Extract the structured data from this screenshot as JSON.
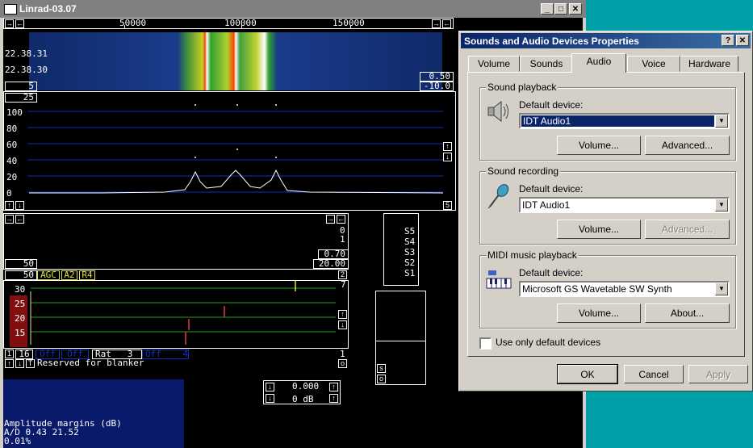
{
  "linrad": {
    "title": "Linrad-03.07",
    "freq_ticks": [
      "50000",
      "100000",
      "150000"
    ],
    "waterfall_times": [
      "22.38.31",
      "22.38.30"
    ],
    "wf_right_top": "0.50",
    "wf_right_bottom": "-10.0",
    "wf_left_value": "5",
    "spectrum_top_value": "25",
    "spectrum_y_labels": [
      "100",
      "80",
      "60",
      "40",
      "20",
      "0"
    ],
    "spectrum_bottom_right": "5",
    "panel2_right_vals": [
      "0",
      "1"
    ],
    "panel2_bottom_right_top": "0.70",
    "panel2_bottom_right": "20.00",
    "panel2_bottom_left": "50",
    "agc_left": "50",
    "agc_labels": [
      "AGC",
      "A2",
      "R4"
    ],
    "agc_right": "2",
    "agc_right2": "7",
    "s_meter": [
      "S5",
      "S4",
      "S3",
      "S2",
      "S1"
    ],
    "agc_y_labels": [
      "30",
      "25",
      "20",
      "15"
    ],
    "status_row": [
      "1",
      "16",
      "Off",
      "Off",
      "Rat",
      "3",
      "Off",
      "4"
    ],
    "status_right": "1",
    "blanker": "Reserved for blanker",
    "blanker_right": "o",
    "so_buttons": [
      "s",
      "o"
    ],
    "readout1": "0.000",
    "readout2": "0 dB",
    "amp_title": "Amplitude margins (dB)",
    "amp_line": "A/D  0.43  21.52",
    "amp_pct": "0.01%"
  },
  "dialog": {
    "title": "Sounds and Audio Devices Properties",
    "tabs": [
      "Volume",
      "Sounds",
      "Audio",
      "Voice",
      "Hardware"
    ],
    "active_tab": "Audio",
    "playback": {
      "group": "Sound playback",
      "label": "Default device:",
      "device": "IDT Audio1",
      "btn_volume": "Volume...",
      "btn_advanced": "Advanced..."
    },
    "recording": {
      "group": "Sound recording",
      "label": "Default device:",
      "device": "IDT Audio1",
      "btn_volume": "Volume...",
      "btn_advanced": "Advanced..."
    },
    "midi": {
      "group": "MIDI music playback",
      "label": "Default device:",
      "device": "Microsoft GS Wavetable SW Synth",
      "btn_volume": "Volume...",
      "btn_about": "About..."
    },
    "checkbox_label": "Use only default devices",
    "btn_ok": "OK",
    "btn_cancel": "Cancel",
    "btn_apply": "Apply"
  }
}
